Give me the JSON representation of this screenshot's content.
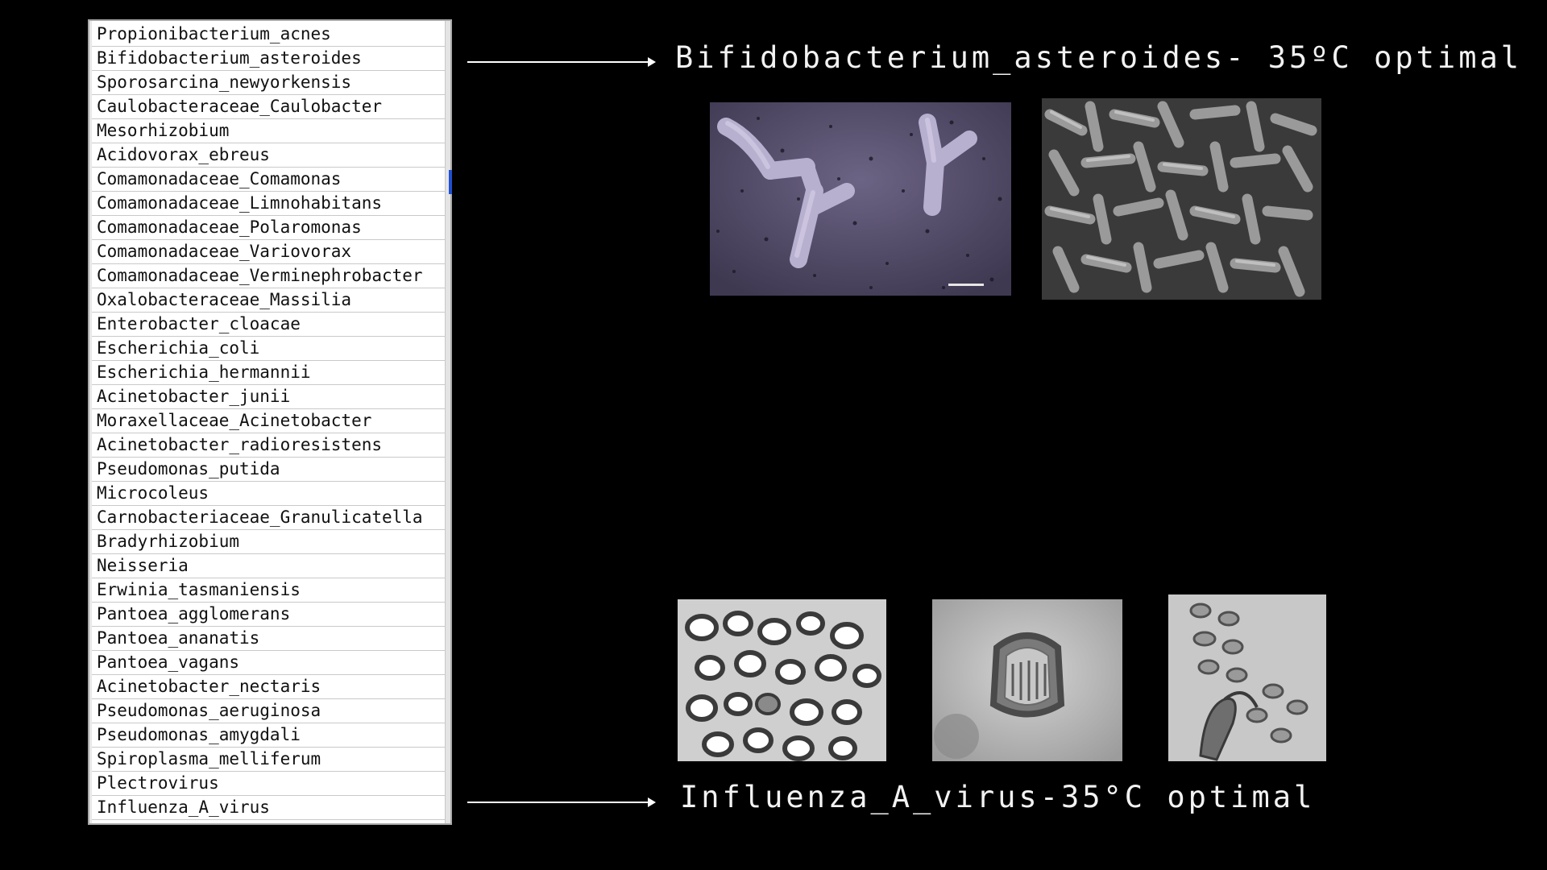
{
  "species_list": [
    "Propionibacterium_acnes",
    "Bifidobacterium_asteroides",
    "Sporosarcina_newyorkensis",
    "Caulobacteraceae_Caulobacter",
    "Mesorhizobium",
    "Acidovorax_ebreus",
    "Comamonadaceae_Comamonas",
    "Comamonadaceae_Limnohabitans",
    "Comamonadaceae_Polaromonas",
    "Comamonadaceae_Variovorax",
    "Comamonadaceae_Verminephrobacter",
    "Oxalobacteraceae_Massilia",
    "Enterobacter_cloacae",
    "Escherichia_coli",
    "Escherichia_hermannii",
    "Acinetobacter_junii",
    "Moraxellaceae_Acinetobacter",
    "Acinetobacter_radioresistens",
    "Pseudomonas_putida",
    "Microcoleus",
    "Carnobacteriaceae_Granulicatella",
    "Bradyrhizobium",
    "Neisseria",
    "Erwinia_tasmaniensis",
    "Pantoea_agglomerans",
    "Pantoea_ananatis",
    "Pantoea_vagans",
    "Acinetobacter_nectaris",
    "Pseudomonas_aeruginosa",
    "Pseudomonas_amygdali",
    "Spiroplasma_melliferum",
    "Plectrovirus",
    "Influenza_A_virus"
  ],
  "annotations": {
    "top": "Bifidobacterium_asteroides- 35ºC optimal",
    "bottom": "Influenza_A_virus-35°C optimal"
  },
  "images": {
    "bifido_1": "bifidobacterium-micrograph-purple",
    "bifido_2": "bifidobacterium-micrograph-sem",
    "flu_1": "influenza-micrograph-cluster",
    "flu_2": "influenza-micrograph-single-virion",
    "flu_3": "influenza-micrograph-budding"
  },
  "colors": {
    "background": "#000000",
    "text": "#f2f2f2",
    "selection": "#1f4fd1"
  }
}
